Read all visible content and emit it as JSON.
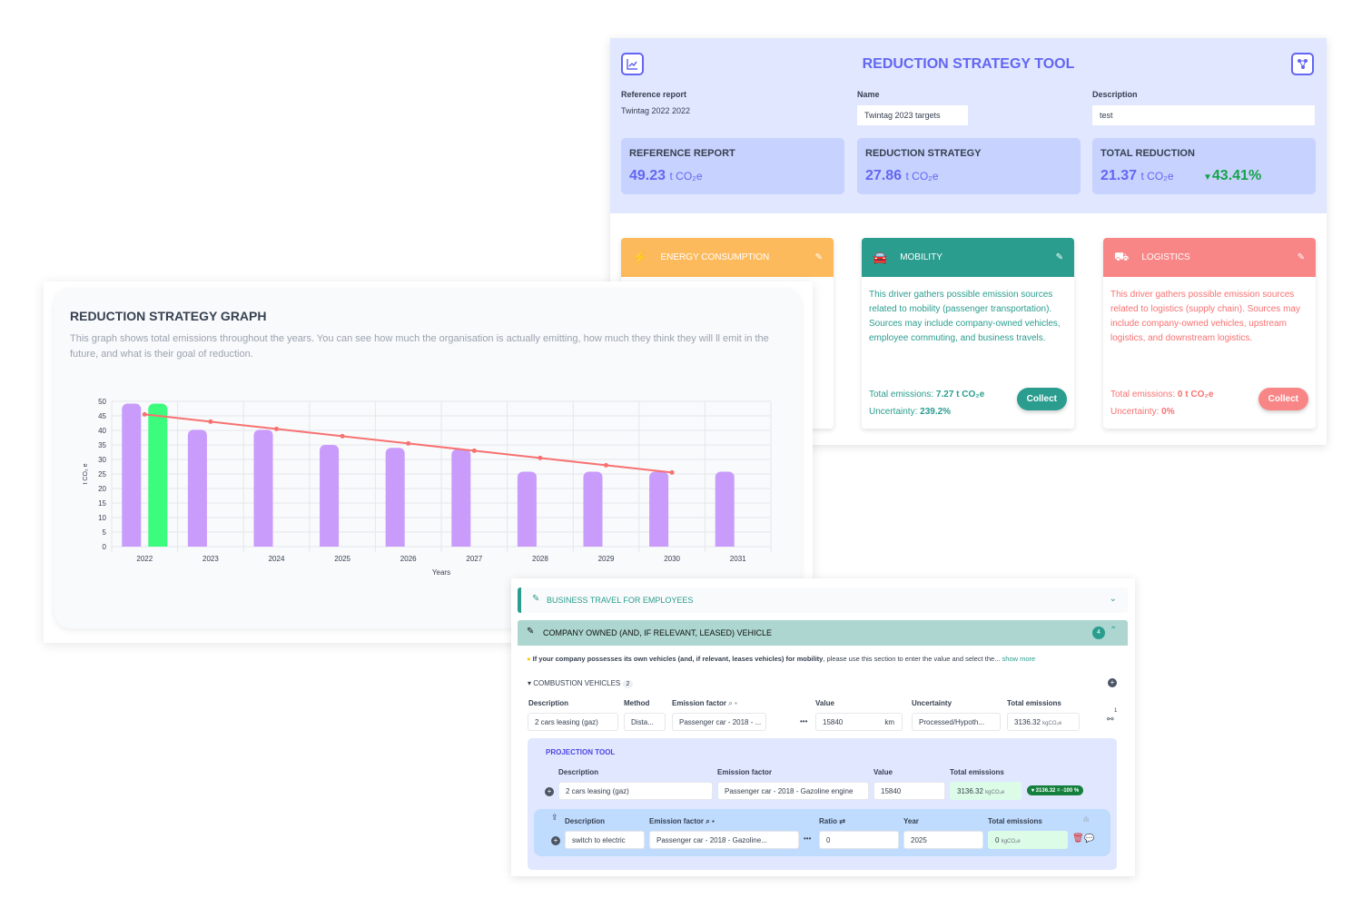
{
  "tool": {
    "title": "REDUCTION STRATEGY TOOL",
    "reference_report_label": "Reference report",
    "reference_report_value": "Twintag 2022 2022",
    "name_label": "Name",
    "name_value": "Twintag 2023 targets",
    "description_label": "Description",
    "description_value": "test",
    "stats": [
      {
        "label": "REFERENCE REPORT",
        "value": "49.23",
        "unit": "t CO₂e"
      },
      {
        "label": "REDUCTION STRATEGY",
        "value": "27.86",
        "unit": "t CO₂e"
      },
      {
        "label": "TOTAL REDUCTION",
        "value": "21.37",
        "unit": "t CO₂e",
        "change": "43.41%"
      }
    ],
    "drivers": [
      {
        "title": "ENERGY CONSUMPTION",
        "color": "#fdba5c",
        "icon": "bolt-icon"
      },
      {
        "title": "MOBILITY",
        "color": "#2a9d8f",
        "icon": "car-icon",
        "text": "This driver gathers possible emission sources related to mobility (passenger transportation). Sources may include company-owned vehicles, employee commuting, and business travels.",
        "total_label": "Total emissions:",
        "total_value": "7.27 t CO₂e",
        "uncertainty_label": "Uncertainty:",
        "uncertainty_value": "239.2%",
        "button": "Collect"
      },
      {
        "title": "LOGISTICS",
        "color": "#f98686",
        "icon": "dolly-icon",
        "text": "This driver gathers possible emission sources related to logistics (supply chain). Sources may include company-owned vehicles, upstream logistics, and downstream logistics.",
        "total_label": "Total emissions:",
        "total_value": "0 t CO₂e",
        "uncertainty_label": "Uncertainty:",
        "uncertainty_value": "0%",
        "button": "Collect"
      }
    ]
  },
  "graph": {
    "title": "REDUCTION STRATEGY GRAPH",
    "description": "This graph shows total emissions throughout the years. You can see how much the organisation is actually emitting, how much they think they will ll emit in the future, and what is their goal of reduction."
  },
  "chart_data": {
    "type": "bar",
    "xlabel": "Years",
    "ylabel": "t CO₂ e",
    "ylim": [
      0,
      50
    ],
    "yticks": [
      0,
      5,
      10,
      15,
      20,
      25,
      30,
      35,
      40,
      45,
      50
    ],
    "grid": true,
    "categories": [
      "2022",
      "2023",
      "2024",
      "2025",
      "2026",
      "2027",
      "2028",
      "2029",
      "2030",
      "2031"
    ],
    "series": [
      {
        "type": "bar",
        "color": "#c99bfb",
        "values": [
          49.2,
          40.2,
          40.2,
          35,
          34,
          33.5,
          25.8,
          25.8,
          25.8,
          25.8
        ]
      },
      {
        "type": "bar",
        "color": "#3cfc7e",
        "values": [
          49.2,
          null,
          null,
          null,
          null,
          null,
          null,
          null,
          null,
          null
        ]
      },
      {
        "type": "line",
        "color": "#f87171",
        "values": [
          45.5,
          43,
          40.5,
          38,
          35.5,
          33,
          30.5,
          28,
          25.5,
          null
        ]
      }
    ]
  },
  "entry": {
    "section1": "BUSINESS TRAVEL FOR EMPLOYEES",
    "section2": "COMPANY OWNED (AND, IF RELEVANT, LEASED) VEHICLE",
    "section2_count": "4",
    "hint_bold": "If your company possesses its own vehicles (and, if relevant, leases vehicles) for mobility",
    "hint": ", please use this section to enter the value and select the...",
    "show_more": "show more",
    "group": "COMBUSTION VEHICLES",
    "group_count": "2",
    "headers": [
      "Description",
      "Method",
      "Emission factor",
      "Value",
      "Uncertainty",
      "Total emissions"
    ],
    "row": {
      "description": "2 cars leasing (gaz)",
      "method": "Dista...",
      "factor": "Passenger car - 2018 - ...",
      "value": "15840",
      "unit": "km",
      "uncertainty": "Processed/Hypoth...",
      "total": "3136.32",
      "total_unit": "kgCO₂e",
      "link_count": "1"
    },
    "projection": {
      "title": "PROJECTION TOOL",
      "headers": [
        "Description",
        "Emission factor",
        "Value",
        "Total emissions"
      ],
      "row": {
        "description": "2 cars leasing (gaz)",
        "factor": "Passenger car - 2018 - Gazoline engine",
        "value": "15840",
        "total": "3136.32",
        "total_unit": "kgCO₂e",
        "badge": "▾ 3136.32 = -100 %"
      },
      "sub_headers": [
        "Description",
        "Emission factor",
        "Ratio",
        "Year",
        "Total emissions"
      ],
      "sub_row": {
        "description": "switch to electric",
        "factor": "Passenger car - 2018 - Gazoline...",
        "ratio": "0",
        "year": "2025",
        "total": "0",
        "total_unit": "kgCO₂e"
      }
    }
  }
}
